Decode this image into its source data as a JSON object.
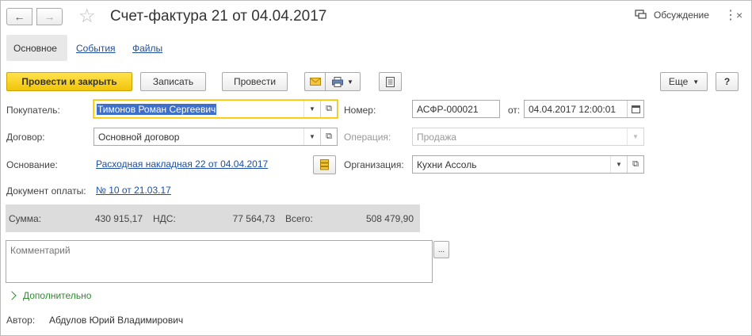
{
  "window": {
    "title": "Счет-фактура 21 от 04.04.2017",
    "discussion_label": "Обсуждение"
  },
  "tabs": [
    {
      "label": "Основное",
      "active": true
    },
    {
      "label": "События",
      "active": false
    },
    {
      "label": "Файлы",
      "active": false
    }
  ],
  "toolbar": {
    "post_close": "Провести и закрыть",
    "save": "Записать",
    "post": "Провести",
    "more": "Еще",
    "help": "?"
  },
  "form": {
    "buyer_label": "Покупатель:",
    "buyer_value": "Тимонов Роман Сергеевич",
    "contract_label": "Договор:",
    "contract_value": "Основной договор",
    "basis_label": "Основание:",
    "basis_value": "Расходная накладная 22 от 04.04.2017",
    "payment_label": "Документ оплаты:",
    "payment_value": "№ 10 от 21.03.17",
    "number_label": "Номер:",
    "number_value": "АСФР-000021",
    "date_label": "от:",
    "date_value": "04.04.2017 12:00:01",
    "operation_label": "Операция:",
    "operation_value": "Продажа",
    "org_label": "Организация:",
    "org_value": "Кухни Ассоль"
  },
  "totals": {
    "sum_label": "Сумма:",
    "sum_value": "430 915,17",
    "vat_label": "НДС:",
    "vat_value": "77 564,73",
    "total_label": "Всего:",
    "total_value": "508 479,90"
  },
  "comment": {
    "placeholder": "Комментарий",
    "more_button": "..."
  },
  "additional_label": "Дополнительно",
  "author": {
    "label": "Автор:",
    "value": "Абдулов Юрий Владимирович"
  },
  "colors": {
    "primary_button": "#f2c40a",
    "link": "#1c4fa3",
    "additional": "#2e8b2e",
    "selection": "#3e70c9",
    "totals_bg": "#dcdcdc"
  }
}
